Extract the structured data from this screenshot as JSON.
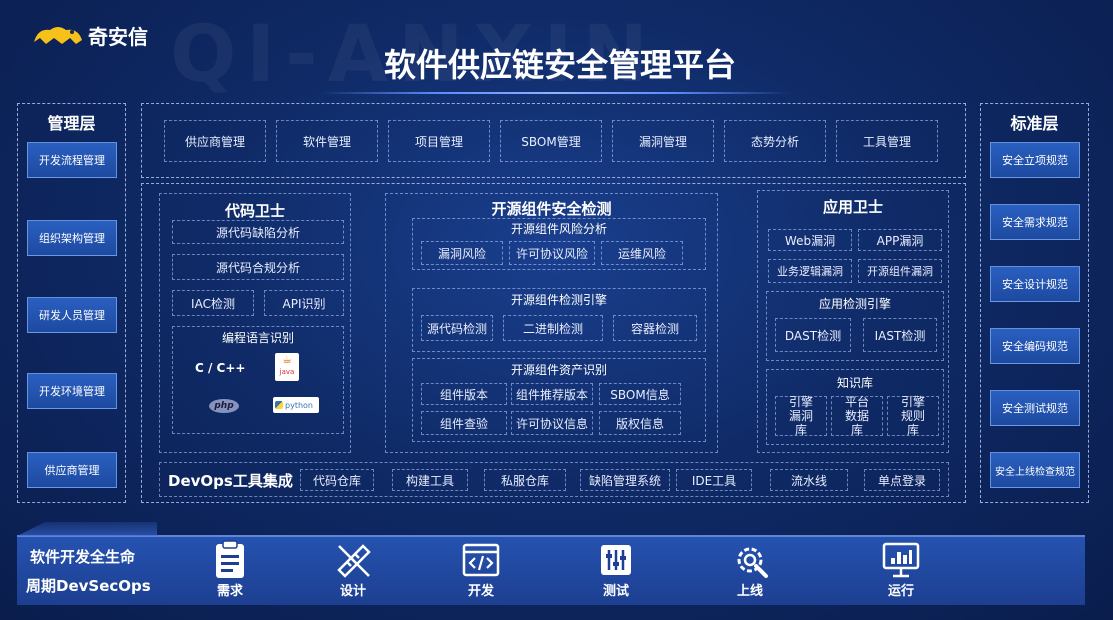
{
  "logo": {
    "brand": "奇安信",
    "mark": "QI-ANXIN"
  },
  "title": "软件供应链安全管理平台",
  "mgmt": {
    "title": "管理层",
    "items": [
      "开发流程管理",
      "组织架构管理",
      "研发人员管理",
      "开发环境管理",
      "供应商管理"
    ]
  },
  "std": {
    "title": "标准层",
    "items": [
      "安全立项规范",
      "安全需求规范",
      "安全设计规范",
      "安全编码规范",
      "安全测试规范",
      "安全上线检查规范"
    ]
  },
  "top_modules": [
    "供应商管理",
    "软件管理",
    "项目管理",
    "SBOM管理",
    "漏洞管理",
    "态势分析",
    "工具管理"
  ],
  "code_guard": {
    "title": "代码卫士",
    "items": [
      "源代码缺陷分析",
      "源代码合规分析",
      "IAC检测",
      "API识别"
    ],
    "lang_title": "编程语言识别",
    "langs": [
      "C / C++",
      "java",
      "php",
      "python"
    ]
  },
  "oss": {
    "title": "开源组件安全检测",
    "risk": {
      "title": "开源组件风险分析",
      "items": [
        "漏洞风险",
        "许可协议风险",
        "运维风险"
      ]
    },
    "engine": {
      "title": "开源组件检测引擎",
      "items": [
        "源代码检测",
        "二进制检测",
        "容器检测"
      ]
    },
    "asset": {
      "title": "开源组件资产识别",
      "items": [
        "组件版本",
        "组件推荐版本",
        "SBOM信息",
        "组件查验",
        "许可协议信息",
        "版权信息"
      ]
    }
  },
  "app_guard": {
    "title": "应用卫士",
    "items": [
      "Web漏洞",
      "APP漏洞",
      "业务逻辑漏洞",
      "开源组件漏洞"
    ],
    "engine": {
      "title": "应用检测引擎",
      "items": [
        "DAST检测",
        "IAST检测"
      ]
    },
    "kb": {
      "title": "知识库",
      "items": [
        "引擎漏洞库",
        "平台数据库",
        "引擎规则库"
      ]
    }
  },
  "devops": {
    "title": "DevOps工具集成",
    "items": [
      "代码仓库",
      "构建工具",
      "私服仓库",
      "缺陷管理系统",
      "IDE工具",
      "流水线",
      "单点登录"
    ]
  },
  "lifecycle": {
    "title_line1": "软件开发全生命",
    "title_line2": "周期DevSecOps",
    "stages": [
      {
        "label": "需求",
        "icon": "clipboard-icon"
      },
      {
        "label": "设计",
        "icon": "ruler-pencil-icon"
      },
      {
        "label": "开发",
        "icon": "code-window-icon"
      },
      {
        "label": "测试",
        "icon": "test-sliders-icon"
      },
      {
        "label": "上线",
        "icon": "gear-wrench-icon"
      },
      {
        "label": "运行",
        "icon": "monitor-chart-icon"
      }
    ]
  },
  "colors": {
    "bg": "#0f2a66",
    "accent": "#2a5fc0",
    "bar": "#1d3f91"
  }
}
